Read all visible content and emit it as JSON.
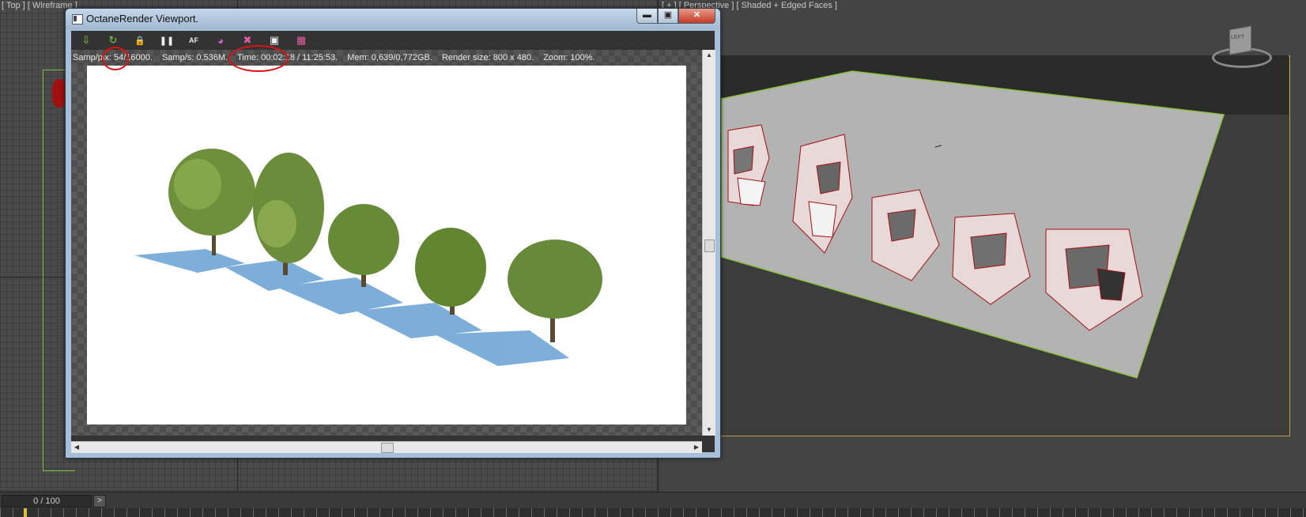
{
  "viewports": {
    "top_label": "[ Top ] [ Wireframe ]",
    "perspective_label": "[ + ] [ Perspective ] [ Shaded + Edged Faces ]",
    "viewcube_label": "LEFT"
  },
  "window": {
    "title": "OctaneRender Viewport.",
    "min_label": "▬",
    "max_label": "▣",
    "close_label": "✕"
  },
  "toolbar": {
    "buttons": [
      {
        "name": "send-scene-icon",
        "glyph": "⇩"
      },
      {
        "name": "restart-render-icon",
        "glyph": "↻"
      },
      {
        "name": "lock-icon",
        "glyph": "🔒"
      },
      {
        "name": "pause-icon",
        "glyph": "❚❚"
      },
      {
        "name": "focus-picker-icon",
        "glyph": "AF"
      },
      {
        "name": "material-picker-icon",
        "glyph": "◕"
      },
      {
        "name": "clay-mode-icon",
        "glyph": "✖"
      },
      {
        "name": "region-render-icon",
        "glyph": "▣"
      },
      {
        "name": "save-image-icon",
        "glyph": "▦"
      }
    ]
  },
  "stats": {
    "samples": "Samp/pix: 54/16000.",
    "samp_rate": "Samp/s: 0,536M.",
    "time": "Time: 00:02:18 / 11:25:53.",
    "memory": "Mem: 0,639/0,772GB.",
    "render_size": "Render size: 800 x 480.",
    "zoom": "Zoom: 100%."
  },
  "timeline": {
    "frame": "0 / 100",
    "next_label": ">"
  }
}
